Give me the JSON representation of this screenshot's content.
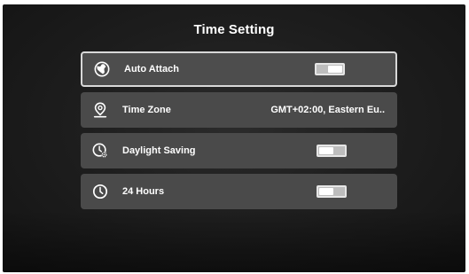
{
  "title": "Time Setting",
  "items": [
    {
      "label": "Auto Attach",
      "icon": "satellite-globe-icon",
      "type": "toggle",
      "on": true,
      "selected": true
    },
    {
      "label": "Time Zone",
      "icon": "location-pin-icon",
      "type": "value",
      "value": "GMT+02:00, Eastern Eu.."
    },
    {
      "label": "Daylight Saving",
      "icon": "clock-gear-icon",
      "type": "toggle",
      "on": false
    },
    {
      "label": "24 Hours",
      "icon": "clock-icon",
      "type": "toggle",
      "on": false
    }
  ]
}
